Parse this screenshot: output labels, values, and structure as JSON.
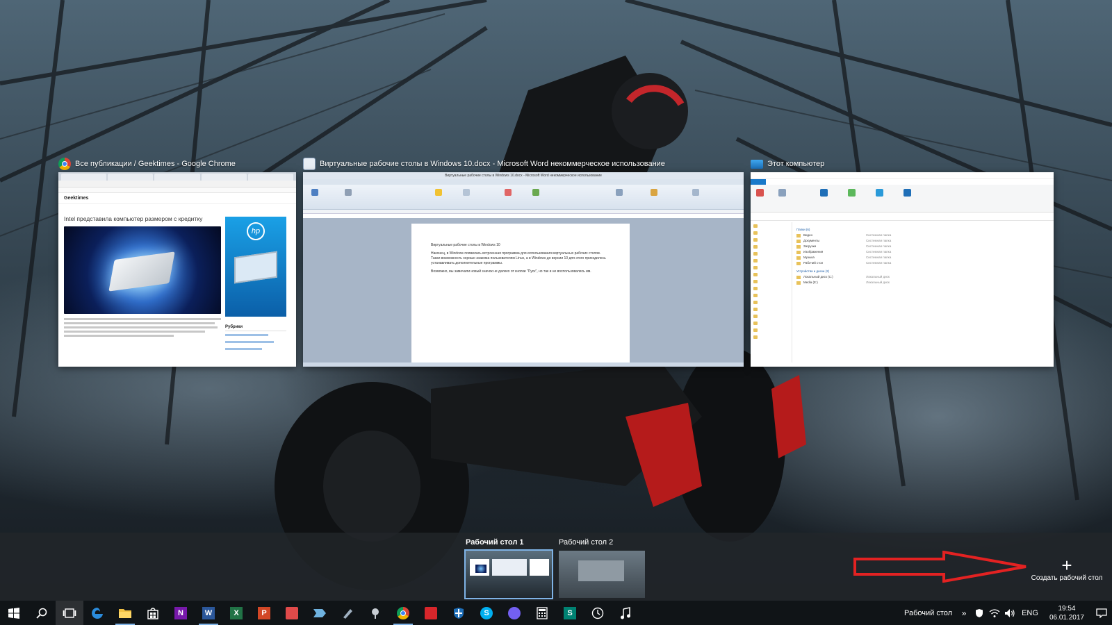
{
  "windows": [
    {
      "id": "chrome",
      "title": "Все публикации / Geektimes - Google Chrome",
      "icon": "chrome-icon",
      "content": {
        "logo": "Geektimes",
        "headline": "Intel представила компьютер размером с кредитку",
        "sidebar_heading": "Рубрики",
        "ad_brand": "hp"
      }
    },
    {
      "id": "word",
      "title": "Виртуальные рабочие столы в Windows 10.docx - Microsoft Word некоммерческое использование",
      "icon": "word-icon",
      "content": {
        "doc_title": "Виртуальные рабочие столы в Windows 10.docx - Microsoft Word некоммерческое использование",
        "p1": "Виртуальные рабочие столы в Windows 10",
        "p2": "Наконец, в Windows появилась встроенная программа для использования виртуальных рабочих столов. Такая возможность хорошо знакома пользователям Linux, а в Windows до версии 10 для этого приходилось устанавливать дополнительные программы.",
        "p3": "Возможно, вы замечали новый значок не далеко от кнопки \"Пуск\", но так и не воспользовались им."
      }
    },
    {
      "id": "explorer",
      "title": "Этот компьютер",
      "icon": "explorer-icon",
      "content": {
        "folders_header": "Папки (6)",
        "folders": [
          "Видео",
          "Документы",
          "Загрузки",
          "Изображения",
          "Музыка",
          "Рабочий стол"
        ],
        "folder_type": "Системная папка",
        "drives_header": "Устройства и диски (2)",
        "drives": [
          "Локальный диск (C:)",
          "Media (E:)"
        ],
        "drive_type": "Локальный диск"
      }
    }
  ],
  "desktops": [
    {
      "label": "Рабочий стол 1",
      "active": true
    },
    {
      "label": "Рабочий стол 2",
      "active": false
    }
  ],
  "new_desktop": {
    "label": "Создать рабочий стол",
    "plus": "+"
  },
  "annotation_arrow_color": "#e32222",
  "taskbar": {
    "apps": [
      {
        "name": "start-button",
        "icon": "windows-icon"
      },
      {
        "name": "search-button",
        "icon": "search-icon"
      },
      {
        "name": "task-view-button",
        "icon": "task-view-icon",
        "highlighted": true
      },
      {
        "name": "edge-button",
        "icon": "edge-icon"
      },
      {
        "name": "explorer-button",
        "icon": "folder-icon",
        "running": true
      },
      {
        "name": "store-button",
        "icon": "store-icon"
      },
      {
        "name": "onenote-button",
        "icon": "onenote-icon"
      },
      {
        "name": "word-button",
        "icon": "word-icon",
        "running": true
      },
      {
        "name": "excel-button",
        "icon": "excel-icon"
      },
      {
        "name": "powerpoint-button",
        "icon": "powerpoint-icon"
      },
      {
        "name": "paint-button",
        "icon": "paint-icon"
      },
      {
        "name": "app-arrow-button",
        "icon": "arrow-app-icon"
      },
      {
        "name": "app-pen-button",
        "icon": "pen-icon"
      },
      {
        "name": "app-brush-button",
        "icon": "brush-icon"
      },
      {
        "name": "chrome-button",
        "icon": "chrome-icon",
        "running": true
      },
      {
        "name": "app-red-button",
        "icon": "red-app-icon"
      },
      {
        "name": "defender-button",
        "icon": "shield-icon"
      },
      {
        "name": "skype-button",
        "icon": "skype-icon"
      },
      {
        "name": "viber-button",
        "icon": "viber-icon"
      },
      {
        "name": "calculator-button",
        "icon": "calculator-icon"
      },
      {
        "name": "sway-button",
        "icon": "sway-icon"
      },
      {
        "name": "alarms-button",
        "icon": "clock-icon"
      },
      {
        "name": "music-button",
        "icon": "music-icon"
      }
    ],
    "tray": {
      "desktop_label": "Рабочий стол",
      "language": "ENG",
      "time": "19:54",
      "date": "06.01.2017"
    }
  }
}
